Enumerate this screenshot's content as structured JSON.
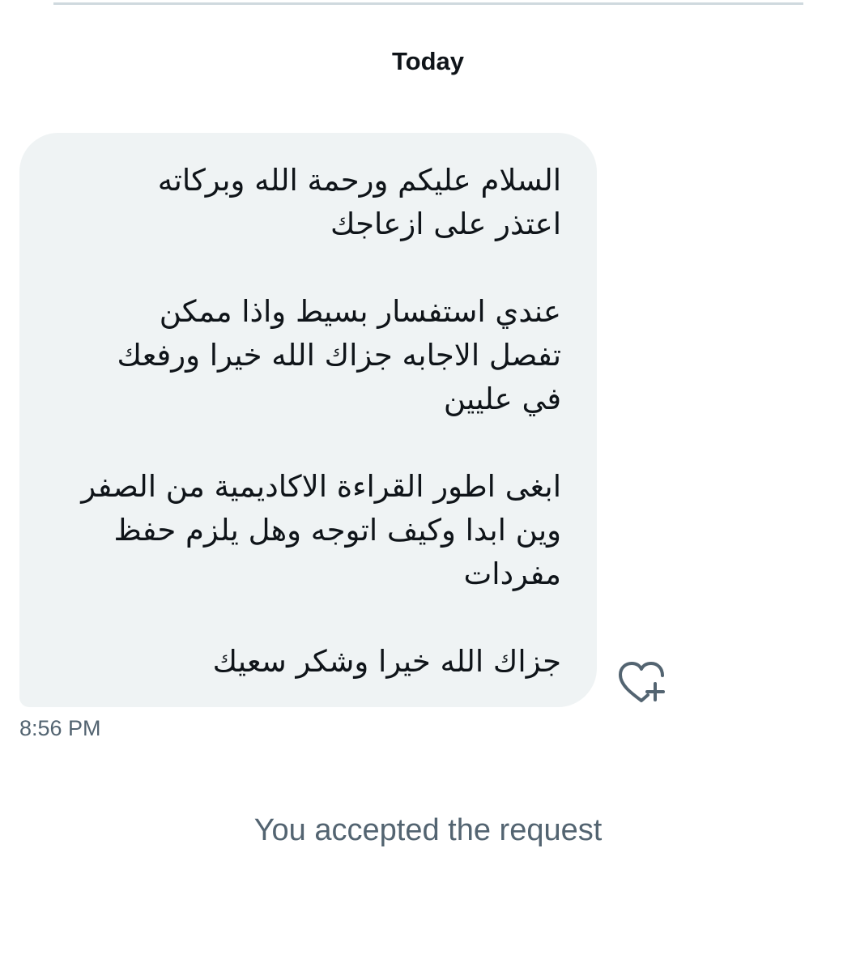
{
  "conversation": {
    "day_label": "Today",
    "message": {
      "paragraphs": [
        [
          "السلام عليكم ورحمة الله وبركاته",
          "اعتذر على ازعاجك"
        ],
        [
          "عندي استفسار بسيط واذا ممكن",
          "تفصل الاجابه جزاك الله خيرا ورفعك",
          "في عليين"
        ],
        [
          "ابغى اطور القراءة الاكاديمية من الصفر",
          "وين ابدا وكيف اتوجه وهل يلزم حفظ",
          "مفردات"
        ],
        [
          "جزاك الله خيرا وشكر سعيك"
        ]
      ],
      "timestamp": "8:56 PM",
      "reaction_icon": "heart-plus-icon"
    },
    "system_note": "You accepted the request"
  },
  "colors": {
    "bubble_bg": "#eff3f4",
    "text_primary": "#0f1419",
    "text_secondary": "#536471",
    "divider": "#cfd9de"
  }
}
